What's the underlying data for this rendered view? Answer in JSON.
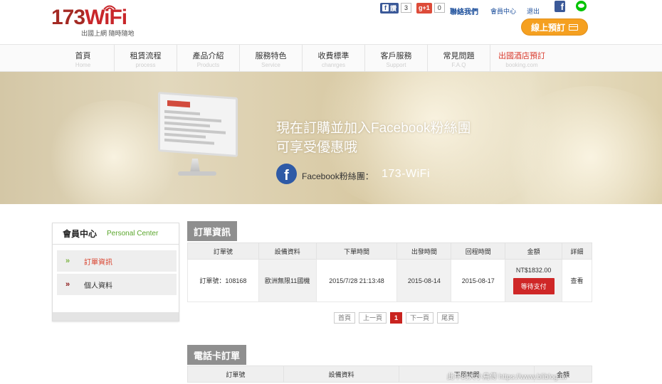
{
  "brand": {
    "logo_text": "173WiFi",
    "tagline": "出國上網 隨時隨地"
  },
  "header": {
    "fb_like_label": "讚",
    "fb_like_count": "3",
    "gplus_label": "g+1",
    "gplus_count": "0",
    "contact": "聯絡我們",
    "member_center": "會員中心",
    "logout": "退出",
    "book_button": "線上預訂"
  },
  "nav": {
    "items": [
      {
        "zh": "首頁",
        "en": "Home"
      },
      {
        "zh": "租賃流程",
        "en": "process"
      },
      {
        "zh": "產品介紹",
        "en": "Products"
      },
      {
        "zh": "服務特色",
        "en": "Service"
      },
      {
        "zh": "收費標準",
        "en": "chanrges"
      },
      {
        "zh": "客戶服務",
        "en": "Support"
      },
      {
        "zh": "常見問題",
        "en": "F.A.Q"
      },
      {
        "zh": "出國酒店預訂",
        "en": "booking.com"
      }
    ]
  },
  "banner": {
    "line1": "現在訂購並加入Facebook粉絲團",
    "line2": "可享受優惠哦",
    "fb_label": "Facebook粉絲團：",
    "fb_name": "173-WiFi"
  },
  "sidebar": {
    "title": "會員中心",
    "title_en": "Personal Center",
    "items": [
      {
        "label": "訂單資訊"
      },
      {
        "label": "個人資料"
      }
    ]
  },
  "orders": {
    "tab": "訂單資訊",
    "headers": [
      "訂單號",
      "設備資料",
      "下單時間",
      "出發時間",
      "回程時間",
      "金額",
      "詳細"
    ],
    "rows": [
      {
        "order_no": "訂單號：108168",
        "device": "歐洲無限11國機",
        "order_time": "2015/7/28 21:13:48",
        "depart": "2015-08-14",
        "return": "2015-08-17",
        "amount": "NT$1832.00",
        "status_button": "等待支付",
        "detail": "查看"
      }
    ],
    "pager": {
      "first": "首頁",
      "prev": "上一頁",
      "current": "1",
      "next": "下一頁",
      "last": "尾頁"
    }
  },
  "phone_orders": {
    "tab": "電話卡訂單",
    "headers": [
      "訂單號",
      "設備資料",
      "下單時間",
      "金額"
    ]
  },
  "watermark": "此中的大小鳥傳 https://www.bliblog.tw"
}
